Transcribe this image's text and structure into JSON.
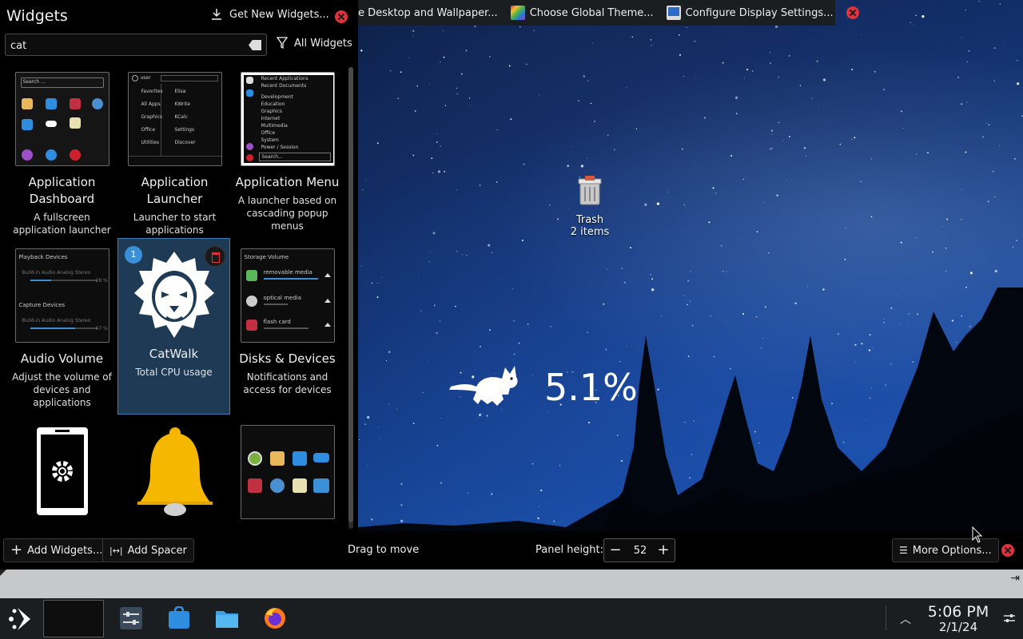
{
  "widgets_panel": {
    "title": "Widgets",
    "get_new_label": "Get New Widgets...",
    "search": {
      "value": "cat",
      "placeholder": ""
    },
    "filter_label": "All Widgets",
    "items": [
      {
        "name": "Application Dashboard",
        "desc": "A fullscreen application launcher"
      },
      {
        "name": "Application Launcher",
        "desc": "Launcher to start applications"
      },
      {
        "name": "Application Menu",
        "desc": "A launcher based on cascading popup menus"
      },
      {
        "name": "Audio Volume",
        "desc": "Adjust the volume of devices and applications"
      },
      {
        "name": "CatWalk",
        "desc": "Total CPU usage",
        "count": "1"
      },
      {
        "name": "Disks & Devices",
        "desc": "Notifications and access for devices"
      }
    ],
    "thumb_text": {
      "dashboard_search": "Search ...",
      "launcher_user": "user",
      "launcher_rows": [
        "Favorites",
        "All Apps",
        "Graphics",
        "Office",
        "Utilities"
      ],
      "launcher_apps": [
        "Elisa",
        "KWrite",
        "KCalc",
        "Settings",
        "Discover"
      ],
      "menu_rows": [
        "Recent Applications",
        "Recent Documents",
        "Development",
        "Education",
        "Graphics",
        "Internet",
        "Multimedia",
        "Office",
        "System",
        "Power / Session"
      ],
      "menu_search": "Search...",
      "audio_playback": "Playback Devices",
      "audio_capture": "Capture Devices",
      "audio_device": "Build-in Audio Analog Stereo",
      "audio_pct_1": "28 %",
      "audio_pct_2": "67 %",
      "disks_title": "Storage Volume",
      "disks_items": [
        "removable media",
        "optical media",
        "flash card"
      ]
    }
  },
  "top_toolbar": {
    "items": [
      {
        "label": "e Desktop and Wallpaper..."
      },
      {
        "label": "Choose Global Theme..."
      },
      {
        "label": "Configure Display Settings..."
      }
    ]
  },
  "desktop": {
    "trash_label": "Trash",
    "trash_count": "2 items",
    "cpu_value": "5.1%"
  },
  "edit_bar": {
    "add_widgets": "Add Widgets...",
    "add_spacer": "Add Spacer",
    "drag_text": "Drag to move",
    "panel_height_label": "Panel height:",
    "panel_height_value": "52",
    "more_options": "More Options..."
  },
  "taskbar": {
    "time": "5:06 PM",
    "date": "2/1/24"
  },
  "colors": {
    "accent": "#3d7eb8",
    "close_red": "#e0323c",
    "panel_bg": "#1b1e20"
  }
}
